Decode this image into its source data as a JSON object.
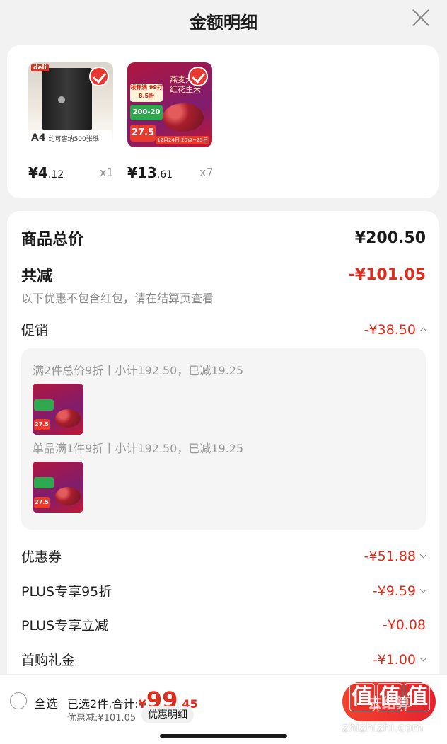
{
  "header": {
    "title": "金额明细"
  },
  "products": [
    {
      "brand": "deli",
      "tag_text": "A4",
      "tag_caption": "约可容纳500张纸",
      "price_int": "¥4",
      "price_dec": ".12",
      "qty": "x1"
    },
    {
      "promo_badge": "领券满 99打8.5折",
      "deal": "200-20",
      "price_tag": "27.5",
      "bag_text": "燕麦大颗 红花生米",
      "date": "12月24日 20点~25日",
      "price_int": "¥13",
      "price_dec": ".61",
      "qty": "x7"
    }
  ],
  "summary": {
    "total_label": "商品总价",
    "total_value": "¥200.50",
    "reduce_label": "共减",
    "reduce_value": "-¥101.05",
    "note": "以下优惠不包含红包，请在结算页查看"
  },
  "promo": {
    "label": "促销",
    "value": "-¥38.50",
    "lines": [
      "满2件总价9折丨小计192.50，已减19.25",
      "单品满1件9折丨小计192.50，已减19.25"
    ],
    "thumb_price": "27.5"
  },
  "discounts": [
    {
      "label": "优惠券",
      "value": "-¥51.88",
      "expandable": true
    },
    {
      "label": "PLUS专享95折",
      "value": "-¥9.59",
      "expandable": true
    },
    {
      "label": "PLUS专享立减",
      "value": "-¥0.08",
      "expandable": false
    },
    {
      "label": "首购礼金",
      "value": "-¥1.00",
      "expandable": true
    }
  ],
  "bottom": {
    "select_all": "全选",
    "selected_text": "已选2件,合计:",
    "yen": "¥",
    "total_int": "99",
    "total_dec": ".45",
    "discount_text": "优惠减:¥101.05",
    "detail_button": "优惠明细",
    "checkout_button": "去结算"
  },
  "watermark": {
    "logo_chars": [
      "值",
      "值",
      "值"
    ],
    "text": "zhizhizhi.com"
  },
  "colors": {
    "accent": "#e02c1d",
    "background": "#f2f2f2"
  }
}
